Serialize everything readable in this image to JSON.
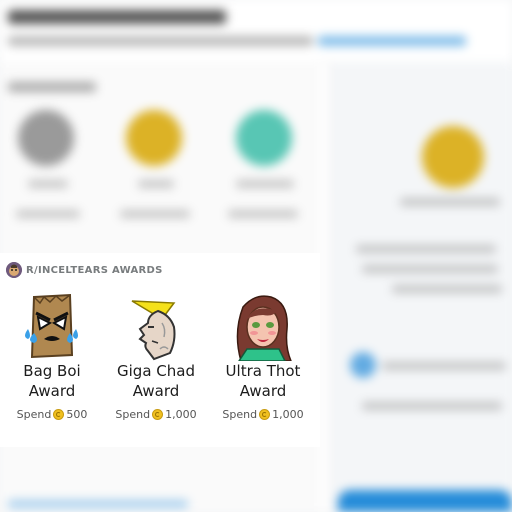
{
  "awards_section": {
    "title": "R/INCELTEARS AWARDS",
    "awards": [
      {
        "name": "Bag Boi Award",
        "spend_label": "Spend",
        "cost": "500"
      },
      {
        "name": "Giga Chad Award",
        "spend_label": "Spend",
        "cost": "1,000"
      },
      {
        "name": "Ultra Thot Award",
        "spend_label": "Spend",
        "cost": "1,000"
      }
    ]
  },
  "colors": {
    "coin": "#f0c020",
    "accent": "#0079d3",
    "muted_text": "#787c7e"
  }
}
